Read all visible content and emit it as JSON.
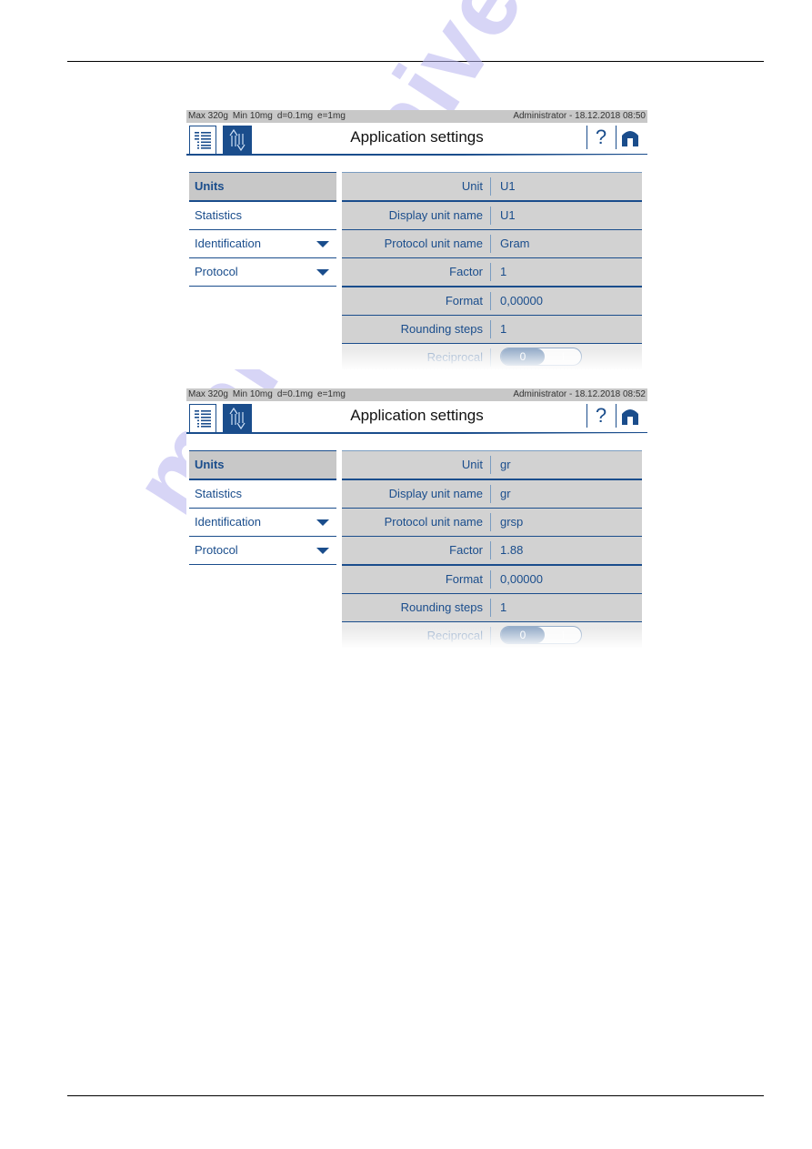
{
  "watermark": "manualshive.com",
  "screens": [
    {
      "status": {
        "specs": [
          "Max 320g",
          "Min 10mg",
          "d=0.1mg",
          "e=1mg"
        ],
        "user": "Administrator",
        "separator": "-",
        "datetime": "18.12.2018 08:50"
      },
      "header": {
        "title": "Application settings",
        "list_icon": "list-icon",
        "swap_icon": "up-down-arrows-icon",
        "help_label": "?",
        "home_icon": "home-icon"
      },
      "sidebar": [
        {
          "label": "Units",
          "active": true,
          "expandable": false
        },
        {
          "label": "Statistics",
          "active": false,
          "expandable": false
        },
        {
          "label": "Identification",
          "active": false,
          "expandable": true
        },
        {
          "label": "Protocol",
          "active": false,
          "expandable": true
        }
      ],
      "settings": [
        {
          "label": "Unit",
          "value": "U1"
        },
        {
          "label": "Display unit name",
          "value": "U1"
        },
        {
          "label": "Protocol unit name",
          "value": "Gram"
        },
        {
          "label": "Factor",
          "value": "1"
        },
        {
          "label": "Format",
          "value": "0,00000"
        },
        {
          "label": "Rounding steps",
          "value": "1"
        },
        {
          "label": "Reciprocal",
          "toggle_on": "0",
          "toggle_off": "I",
          "selected": "0"
        }
      ]
    },
    {
      "status": {
        "specs": [
          "Max 320g",
          "Min 10mg",
          "d=0.1mg",
          "e=1mg"
        ],
        "user": "Administrator",
        "separator": "-",
        "datetime": "18.12.2018 08:52"
      },
      "header": {
        "title": "Application settings",
        "list_icon": "list-icon",
        "swap_icon": "up-down-arrows-icon",
        "help_label": "?",
        "home_icon": "home-icon"
      },
      "sidebar": [
        {
          "label": "Units",
          "active": true,
          "expandable": false
        },
        {
          "label": "Statistics",
          "active": false,
          "expandable": false
        },
        {
          "label": "Identification",
          "active": false,
          "expandable": true
        },
        {
          "label": "Protocol",
          "active": false,
          "expandable": true
        }
      ],
      "settings": [
        {
          "label": "Unit",
          "value": "gr"
        },
        {
          "label": "Display unit name",
          "value": "gr"
        },
        {
          "label": "Protocol unit name",
          "value": "grsp"
        },
        {
          "label": "Factor",
          "value": "1.88"
        },
        {
          "label": "Format",
          "value": "0,00000"
        },
        {
          "label": "Rounding steps",
          "value": "1"
        },
        {
          "label": "Reciprocal",
          "toggle_on": "0",
          "toggle_off": "I",
          "selected": "0"
        }
      ]
    }
  ]
}
